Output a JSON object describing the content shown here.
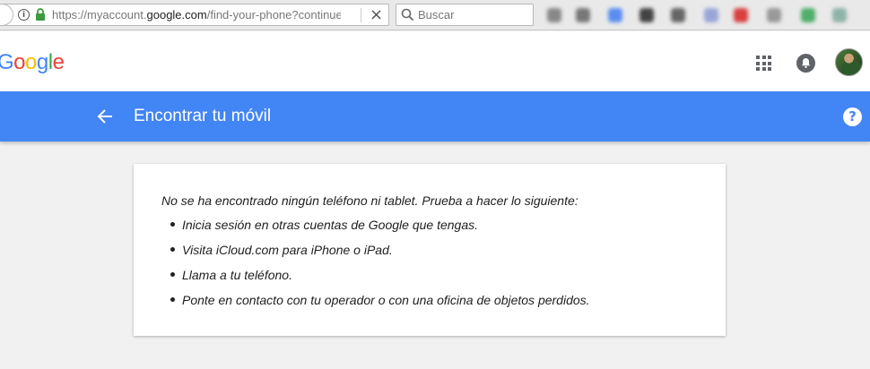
{
  "browser": {
    "url_prefix": "https://myaccount.",
    "url_domain": "google.com",
    "url_suffix": "/find-your-phone?continue=",
    "search_placeholder": "Buscar"
  },
  "header": {
    "logo_letters": [
      {
        "ch": "G",
        "color": "#4285f4"
      },
      {
        "ch": "o",
        "color": "#ea4335"
      },
      {
        "ch": "o",
        "color": "#fbbc05"
      },
      {
        "ch": "g",
        "color": "#4285f4"
      },
      {
        "ch": "l",
        "color": "#34a853"
      },
      {
        "ch": "e",
        "color": "#ea4335"
      }
    ]
  },
  "appbar": {
    "title": "Encontrar tu móvil",
    "help_label": "?"
  },
  "card": {
    "intro": "No se ha encontrado ningún teléfono ni tablet. Prueba a hacer lo siguiente:",
    "tips": [
      "Inicia sesión en otras cuentas de Google que tengas.",
      "Visita iCloud.com para iPhone o iPad.",
      "Llama a tu teléfono.",
      "Ponte en contacto con tu operador o con una oficina de objetos perdidos."
    ]
  },
  "colors": {
    "accent": "#4285f4",
    "background": "#f1f1f1"
  }
}
